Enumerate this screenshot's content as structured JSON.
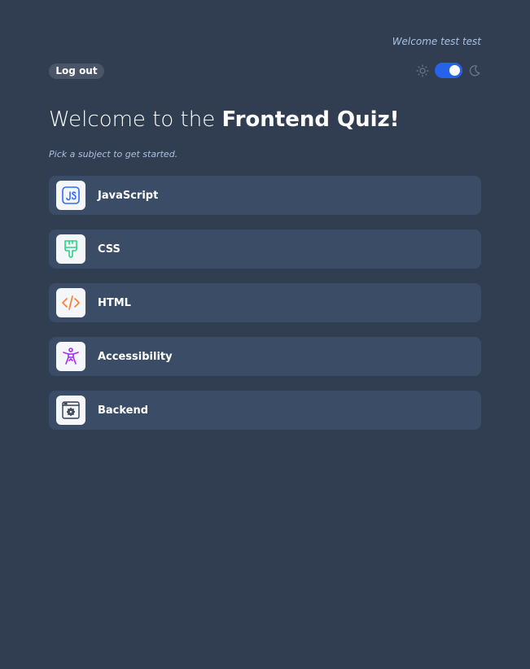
{
  "header": {
    "welcome_text": "Welcome test test",
    "logout_label": "Log out",
    "theme": {
      "dark_mode_on": true,
      "accent_color": "#2563eb",
      "sun_icon": "sun-icon",
      "moon_icon": "moon-icon"
    }
  },
  "main": {
    "title_prefix": "Welcome to the ",
    "title_bold": "Frontend Quiz!",
    "subtitle": "Pick a subject to get started.",
    "subjects": [
      {
        "label": "JavaScript",
        "icon": "javascript-icon",
        "color": "#306aff"
      },
      {
        "label": "CSS",
        "icon": "css-brush-icon",
        "color": "#26d782"
      },
      {
        "label": "HTML",
        "icon": "html-code-icon",
        "color": "#ff7e35"
      },
      {
        "label": "Accessibility",
        "icon": "accessibility-icon",
        "color": "#a729f5"
      },
      {
        "label": "Backend",
        "icon": "backend-gear-icon",
        "color": "#313e51"
      }
    ]
  },
  "colors": {
    "background": "#313e51",
    "card": "#3b4d66",
    "muted_text": "#abc1e1"
  }
}
